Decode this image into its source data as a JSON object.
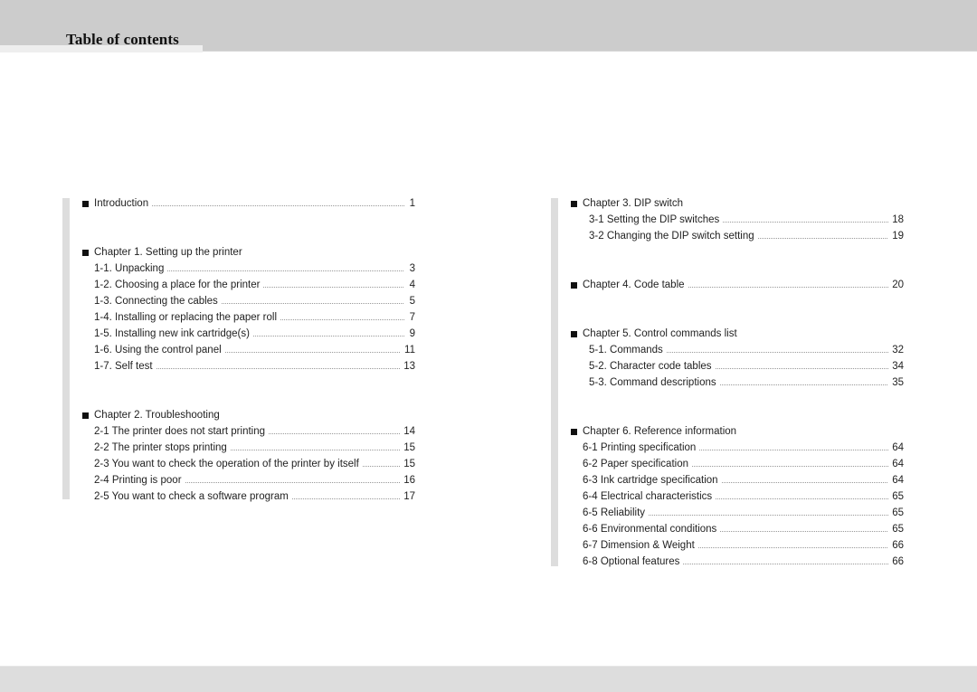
{
  "header": {
    "title": "Table of contents"
  },
  "left_column": {
    "entries": [
      {
        "label": "Introduction",
        "page": "1",
        "level": 0,
        "leader": true
      },
      {
        "label": "Chapter 1. Setting up the printer",
        "page": "",
        "level": 0,
        "leader": false
      },
      {
        "label": "1-1. Unpacking",
        "page": "3",
        "level": 1,
        "leader": true
      },
      {
        "label": "1-2. Choosing a place for the printer",
        "page": "4",
        "level": 1,
        "leader": true
      },
      {
        "label": "1-3. Connecting the cables",
        "page": "5",
        "level": 1,
        "leader": true
      },
      {
        "label": "1-4. Installing or replacing the paper roll",
        "page": "7",
        "level": 1,
        "leader": true
      },
      {
        "label": "1-5. Installing new ink cartridge(s)",
        "page": "9",
        "level": 1,
        "leader": true
      },
      {
        "label": "1-6. Using the control panel",
        "page": "11",
        "level": 1,
        "leader": true
      },
      {
        "label": "1-7. Self test",
        "page": "13",
        "level": 1,
        "leader": true
      },
      {
        "label": "Chapter 2. Troubleshooting",
        "page": "",
        "level": 0,
        "leader": false
      },
      {
        "label": "2-1 The printer does not start printing",
        "page": "14",
        "level": 1,
        "leader": true
      },
      {
        "label": "2-2 The printer stops printing",
        "page": "15",
        "level": 1,
        "leader": true
      },
      {
        "label": "2-3 You want to check the operation of the printer by itself",
        "page": "15",
        "level": 1,
        "leader": true
      },
      {
        "label": "2-4 Printing is poor",
        "page": "16",
        "level": 1,
        "leader": true
      },
      {
        "label": "2-5 You want to check a software program",
        "page": "17",
        "level": 1,
        "leader": true
      }
    ]
  },
  "right_column": {
    "entries": [
      {
        "label": "Chapter 3. DIP switch",
        "page": "",
        "level": 0,
        "leader": false
      },
      {
        "label": "3-1 Setting the DIP switches",
        "page": "18",
        "level": 2,
        "leader": true
      },
      {
        "label": "3-2 Changing the DIP switch setting",
        "page": "19",
        "level": 2,
        "leader": true
      },
      {
        "label": "Chapter 4. Code table",
        "page": "20",
        "level": 0,
        "leader": true
      },
      {
        "label": "Chapter 5. Control commands list",
        "page": "",
        "level": 0,
        "leader": false
      },
      {
        "label": "5-1. Commands",
        "page": "32",
        "level": 2,
        "leader": true
      },
      {
        "label": "5-2. Character code tables",
        "page": "34",
        "level": 2,
        "leader": true
      },
      {
        "label": "5-3. Command descriptions",
        "page": "35",
        "level": 2,
        "leader": true
      },
      {
        "label": "Chapter 6. Reference information",
        "page": "",
        "level": 0,
        "leader": false
      },
      {
        "label": "6-1 Printing specification",
        "page": "64",
        "level": 1,
        "leader": true
      },
      {
        "label": "6-2 Paper specification",
        "page": "64",
        "level": 1,
        "leader": true
      },
      {
        "label": "6-3 Ink cartridge specification",
        "page": "64",
        "level": 1,
        "leader": true
      },
      {
        "label": "6-4 Electrical characteristics",
        "page": "65",
        "level": 1,
        "leader": true
      },
      {
        "label": "6-5 Reliability",
        "page": "65",
        "level": 1,
        "leader": true
      },
      {
        "label": "6-6 Environmental conditions",
        "page": "65",
        "level": 1,
        "leader": true
      },
      {
        "label": "6-7 Dimension & Weight",
        "page": "66",
        "level": 1,
        "leader": true
      },
      {
        "label": "6-8 Optional features",
        "page": "66",
        "level": 1,
        "leader": true
      }
    ]
  }
}
